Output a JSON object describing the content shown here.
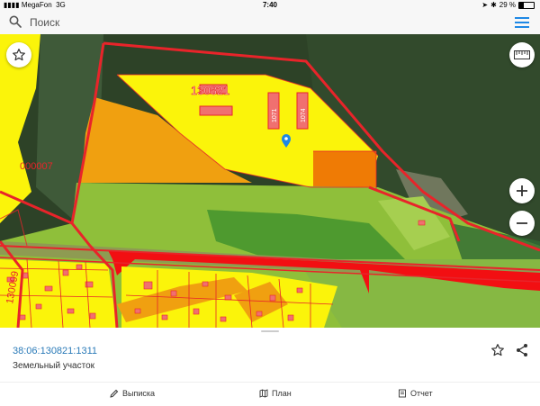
{
  "status_bar": {
    "carrier": "MegaFon",
    "network": "3G",
    "time": "7:40",
    "battery": "29 %",
    "battery_level": 0.29
  },
  "search": {
    "placeholder": "Поиск"
  },
  "map": {
    "labels": {
      "parcel_main": "130821",
      "parcel_left": "000007",
      "parcel_bottom_left": "130099",
      "building_a": "1071",
      "building_b": "1074"
    },
    "icons": {
      "favorite": "star-icon",
      "ruler": "ruler-icon",
      "zoom_in": "plus-icon",
      "zoom_out": "minus-icon",
      "pin": "location-pin-icon"
    },
    "colors": {
      "boundary": "#e8242a",
      "parcel_yellow": "#fbf40a",
      "parcel_orange": "#f0a010",
      "parcel_dark_orange": "#ef7b05",
      "parcel_green": "#8fbf3a",
      "road_red": "#f20f12",
      "pin": "#1e88e5"
    }
  },
  "details": {
    "cadastral_number": "38:06:130821:1311",
    "object_type": "Земельный участок"
  },
  "tabs": [
    {
      "label": "Выписка",
      "icon": "pencil-icon"
    },
    {
      "label": "План",
      "icon": "map-icon"
    },
    {
      "label": "Отчет",
      "icon": "document-icon"
    }
  ]
}
